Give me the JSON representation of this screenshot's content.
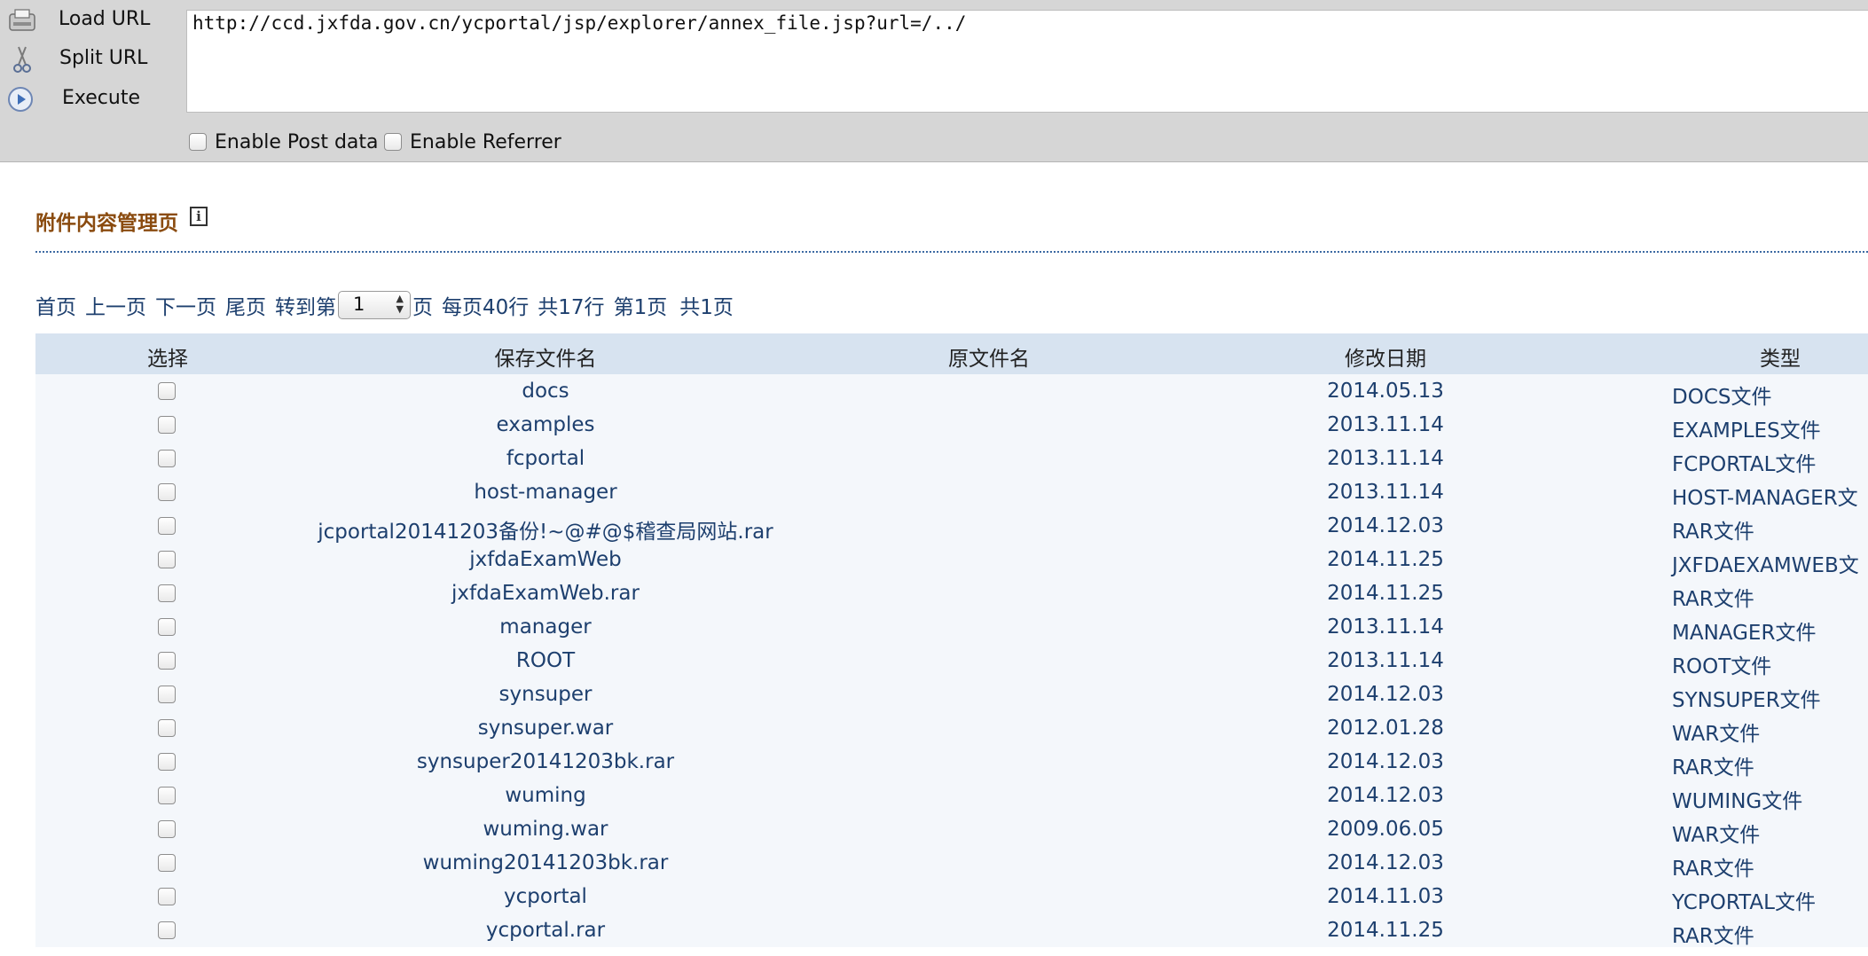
{
  "toolbar": {
    "load_url_label": "Load URL",
    "split_url_label": "Split URL",
    "execute_label": "Execute",
    "url_value": "http://ccd.jxfda.gov.cn/ycportal/jsp/explorer/annex_file.jsp?url=/../",
    "enable_post_label": "Enable Post data",
    "enable_referrer_label": "Enable Referrer"
  },
  "page": {
    "title": "附件内容管理页",
    "info_glyph": "i"
  },
  "pager": {
    "first": "首页",
    "prev": "上一页",
    "next": "下一页",
    "last": "尾页",
    "goto_prefix": "转到第",
    "goto_value": "1",
    "goto_suffix": "页",
    "per_page": "每页40行",
    "total_rows": "共17行",
    "current": "第1页",
    "total_pages": "共1页"
  },
  "table": {
    "headers": {
      "select": "选择",
      "saved_name": "保存文件名",
      "original_name": "原文件名",
      "modified": "修改日期",
      "type": "类型"
    },
    "rows": [
      {
        "saved": "docs",
        "original": "",
        "date": "2014.05.13",
        "type": "DOCS文件"
      },
      {
        "saved": "examples",
        "original": "",
        "date": "2013.11.14",
        "type": "EXAMPLES文件"
      },
      {
        "saved": "fcportal",
        "original": "",
        "date": "2013.11.14",
        "type": "FCPORTAL文件"
      },
      {
        "saved": "host-manager",
        "original": "",
        "date": "2013.11.14",
        "type": "HOST-MANAGER文"
      },
      {
        "saved": "jcportal20141203备份!~@#@$稽查局网站.rar",
        "original": "",
        "date": "2014.12.03",
        "type": "RAR文件"
      },
      {
        "saved": "jxfdaExamWeb",
        "original": "",
        "date": "2014.11.25",
        "type": "JXFDAEXAMWEB文"
      },
      {
        "saved": "jxfdaExamWeb.rar",
        "original": "",
        "date": "2014.11.25",
        "type": "RAR文件"
      },
      {
        "saved": "manager",
        "original": "",
        "date": "2013.11.14",
        "type": "MANAGER文件"
      },
      {
        "saved": "ROOT",
        "original": "",
        "date": "2013.11.14",
        "type": "ROOT文件"
      },
      {
        "saved": "synsuper",
        "original": "",
        "date": "2014.12.03",
        "type": "SYNSUPER文件"
      },
      {
        "saved": "synsuper.war",
        "original": "",
        "date": "2012.01.28",
        "type": "WAR文件"
      },
      {
        "saved": "synsuper20141203bk.rar",
        "original": "",
        "date": "2014.12.03",
        "type": "RAR文件"
      },
      {
        "saved": "wuming",
        "original": "",
        "date": "2014.12.03",
        "type": "WUMING文件"
      },
      {
        "saved": "wuming.war",
        "original": "",
        "date": "2009.06.05",
        "type": "WAR文件"
      },
      {
        "saved": "wuming20141203bk.rar",
        "original": "",
        "date": "2014.12.03",
        "type": "RAR文件"
      },
      {
        "saved": "ycportal",
        "original": "",
        "date": "2014.11.03",
        "type": "YCPORTAL文件"
      },
      {
        "saved": "ycportal.rar",
        "original": "",
        "date": "2014.11.25",
        "type": "RAR文件"
      }
    ]
  },
  "colors": {
    "toolbar_bg": "#d6d6d6",
    "heading": "#8a4b0f",
    "link": "#1d3f6e",
    "header_bg": "#d7e3f0",
    "row_bg": "#f4f7fb"
  }
}
